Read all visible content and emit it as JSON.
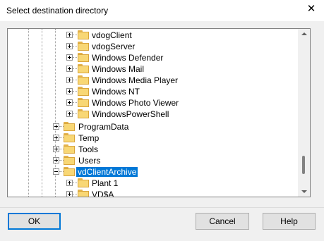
{
  "window": {
    "title": "Select destination directory",
    "close_icon": "close-icon"
  },
  "tree": {
    "rows": [
      {
        "label": "vdogClient",
        "expanded": false,
        "selected": false
      },
      {
        "label": "vdogServer",
        "expanded": false,
        "selected": false
      },
      {
        "label": "Windows Defender",
        "expanded": false,
        "selected": false
      },
      {
        "label": "Windows Mail",
        "expanded": false,
        "selected": false
      },
      {
        "label": "Windows Media Player",
        "expanded": false,
        "selected": false
      },
      {
        "label": "Windows NT",
        "expanded": false,
        "selected": false
      },
      {
        "label": "Windows Photo Viewer",
        "expanded": false,
        "selected": false
      },
      {
        "label": "WindowsPowerShell",
        "expanded": false,
        "selected": false
      },
      {
        "label": "ProgramData",
        "expanded": false,
        "selected": false
      },
      {
        "label": "Temp",
        "expanded": false,
        "selected": false
      },
      {
        "label": "Tools",
        "expanded": false,
        "selected": false
      },
      {
        "label": "Users",
        "expanded": false,
        "selected": false
      },
      {
        "label": "vdClientArchive",
        "expanded": true,
        "selected": true
      },
      {
        "label": "Plant 1",
        "expanded": false,
        "selected": false
      },
      {
        "label": "VD$A",
        "expanded": false,
        "selected": false
      }
    ],
    "selection_color": "#0078d7"
  },
  "buttons": {
    "ok": "OK",
    "cancel": "Cancel",
    "help": "Help"
  }
}
